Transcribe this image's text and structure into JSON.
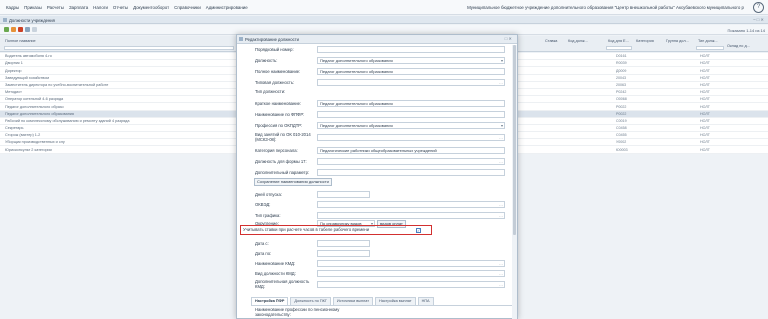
{
  "menu": [
    "Кадры",
    "Приказы",
    "Расчеты",
    "Зарплата",
    "Налоги",
    "Отчеты",
    "Документооборот",
    "Справочники",
    "Администрирование"
  ],
  "org_name": "Муниципальное бюджетное учреждение дополнительного образования \"Центр внешкольной работы\" Аксубаевского муниципального р",
  "window_title": "Должности учреждения",
  "pager": "Показано 1-14 из 14",
  "columns": [
    "Полное название",
    "Ставка",
    "Код долж...",
    "Код для Е...",
    "Категория",
    "Группа дол...",
    "Тип долж...",
    "Оклад по д..."
  ],
  "rows": [
    {
      "name": "Водитель автомобиля 4-го",
      "code": "D0161",
      "type": "НОЛТ"
    },
    {
      "name": "Дворник 1",
      "code": "R0039",
      "type": "НОЛТ"
    },
    {
      "name": "Директор",
      "code": "Д0009",
      "type": "НОЛТ"
    },
    {
      "name": "Заведующий хозяйством",
      "code": "20043",
      "type": "НОЛТ"
    },
    {
      "name": "Заместитель директора по учебно-воспитательной работе",
      "code": "20063",
      "type": "НОЛТ"
    },
    {
      "name": "Методист",
      "code": "P0242",
      "type": "НОЛТ"
    },
    {
      "name": "Оператор котельной 4-6 разряда",
      "code": "О0068",
      "type": "НОЛТ"
    },
    {
      "name": "Педагог дополнительного образо",
      "code": "P0022",
      "type": "НОЛТ"
    },
    {
      "name": "Педагог дополнительного образования",
      "code": "P0022",
      "type": "НОЛТ"
    },
    {
      "name": "Рабочий по комплексному обслуживанию и ремонту зданий 4 разряда",
      "code": "С0019",
      "type": "НОЛТ"
    },
    {
      "name": "Секретарь",
      "code": "С0458",
      "type": "НОЛТ"
    },
    {
      "name": "Сторож (вахтер) 1-2",
      "code": "С0455",
      "type": "НОЛТ"
    },
    {
      "name": "Уборщик производственных и слу",
      "code": "У0002",
      "type": "НОЛТ"
    },
    {
      "name": "Юрисконсульт 2 категории",
      "code": "Ю0003",
      "type": "НОЛТ"
    }
  ],
  "selected_row": 8,
  "dialog": {
    "title": "Редактирование должности",
    "fields": {
      "num_label": "Порядковый номер:",
      "post_label": "Должность:",
      "post_value": "Педагог дополнительного образования",
      "fullname_label": "Полное наименование:",
      "fullname_value": "Педагог дополнительного образования",
      "typical_label": "Типовая должность:",
      "type_label": "Тип должности:",
      "short_label": "Краткое наименование:",
      "short_value": "Педагог дополнительного образования",
      "fpf_label": "Наименование по ФПФР:",
      "okpdtr_label": "Профессия по ОКПДТР:",
      "okpdtr_value": "Педагог дополнительного образования",
      "kind_label": "Вид занятий по ОК 010-2014 (МСКЗ-08):",
      "cat_label": "Категория персонала:",
      "cat_value": "Педагогические работники общеобразовательных учреждений",
      "f17_label": "Должность для формы 17:",
      "extra_label": "Дополнительный параметр:",
      "vac_label": "Дней отпуска:",
      "okved_label": "ОКВЭД:",
      "graph_label": "Тип графика:",
      "round_label": "Округление:",
      "round_value": "По справочнику видов",
      "round_value2": "видов оплат",
      "acc_label": "Учитывать ставки при расчете часов в табеле рабочего времени",
      "acc_checked": "✓",
      "date_from_label": "Дата с:",
      "date_to_label": "Дата по:",
      "kmd_label": "Наименование КМД:",
      "kmd_kind_label": "Вид должности КМД:",
      "kmd_add_label": "Дополнительная должность КМД:",
      "pension_label": "Наименование профессии по пенсионному законодательству:"
    },
    "button": "Сохранение наименования должности",
    "tabs": [
      "Настройка ПФР",
      "Должность по ПКГ",
      "Источники выплат",
      "Настройка выплат",
      "НПА"
    ]
  }
}
